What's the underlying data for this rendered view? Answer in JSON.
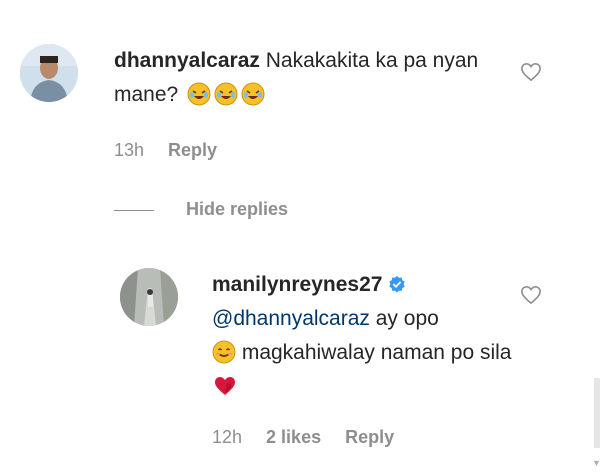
{
  "comments": [
    {
      "username": "dhannyalcaraz",
      "text": "Nakakakita ka pa nyan mane?",
      "emojis": [
        "rofl",
        "rofl",
        "rofl"
      ],
      "time": "13h",
      "reply_label": "Reply"
    }
  ],
  "replies_toggle": "Hide replies",
  "reply": {
    "username": "manilynreynes27",
    "verified": true,
    "mention": "@dhannyalcaraz",
    "text_part1": " ay opo ",
    "emoji1": "smiling-face",
    "text_part2": " magkahiwalay naman po sila",
    "emoji2": "heart-exclamation",
    "time": "12h",
    "likes": "2 likes",
    "reply_label": "Reply"
  },
  "colors": {
    "text": "#262626",
    "muted": "#8e8e8e",
    "mention": "#00376b",
    "verified": "#3897f0"
  }
}
